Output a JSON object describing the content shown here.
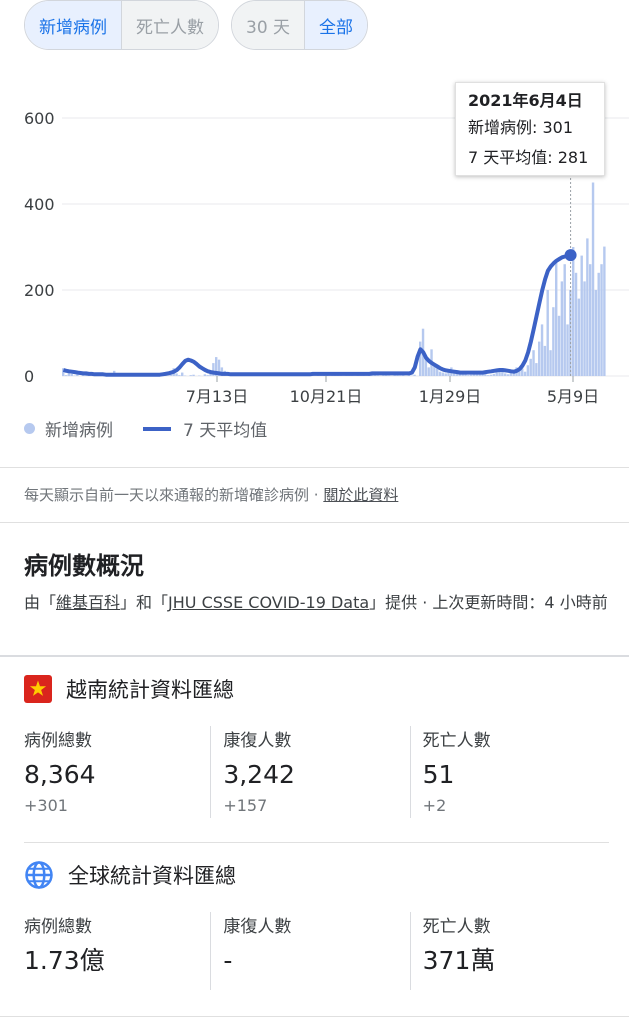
{
  "filters": {
    "metric_tabs": [
      "新增病例",
      "死亡人數"
    ],
    "range_tabs": [
      "30 天",
      "全部"
    ]
  },
  "chart_data": {
    "type": "bar",
    "x_tick_labels": [
      "7月13日",
      "10月21日",
      "1月29日",
      "5月9日"
    ],
    "y_ticks": [
      0,
      200,
      400,
      600
    ],
    "ylim": [
      0,
      600
    ],
    "series": [
      {
        "name": "新增病例",
        "type": "bar",
        "color": "#b6c9ef",
        "values": [
          18,
          2,
          10,
          5,
          1,
          3,
          0,
          8,
          2,
          1,
          0,
          4,
          2,
          0,
          5,
          1,
          0,
          3,
          12,
          1,
          0,
          2,
          6,
          0,
          1,
          3,
          0,
          0,
          4,
          1,
          2,
          0,
          1,
          0,
          2,
          5,
          1,
          0,
          3,
          18,
          6,
          2,
          8,
          1,
          0,
          2,
          3,
          0,
          1,
          0,
          4,
          2,
          8,
          30,
          44,
          38,
          20,
          12,
          8,
          6,
          4,
          3,
          2,
          5,
          1,
          0,
          2,
          3,
          6,
          1,
          0,
          2,
          4,
          0,
          1,
          2,
          0,
          1,
          5,
          2,
          1,
          0,
          3,
          1,
          2,
          0,
          1,
          4,
          2,
          0,
          3,
          1,
          6,
          2,
          0,
          1,
          2,
          5,
          1,
          0,
          2,
          3,
          1,
          0,
          4,
          1,
          2,
          0,
          8,
          2,
          3,
          1,
          0,
          2,
          4,
          1,
          0,
          3,
          2,
          1,
          6,
          0,
          2,
          1,
          3,
          0,
          80,
          110,
          40,
          20,
          62,
          30,
          18,
          10,
          8,
          6,
          12,
          20,
          14,
          8,
          5,
          4,
          6,
          2,
          3,
          8,
          5,
          12,
          6,
          4,
          2,
          3,
          5,
          8,
          10,
          12,
          6,
          4,
          8,
          14,
          20,
          12,
          18,
          10,
          25,
          40,
          60,
          30,
          80,
          120,
          70,
          200,
          60,
          160,
          270,
          140,
          220,
          260,
          120,
          200,
          300,
          240,
          180,
          280,
          220,
          320,
          260,
          450,
          200,
          240,
          260,
          301
        ]
      },
      {
        "name": "7 天平均值",
        "type": "line",
        "color": "#3c62c6",
        "values": [
          14,
          12,
          11,
          10,
          9,
          8,
          7,
          6,
          6,
          5,
          5,
          4,
          4,
          4,
          4,
          3,
          3,
          3,
          3,
          3,
          3,
          3,
          3,
          3,
          3,
          3,
          3,
          3,
          3,
          3,
          3,
          3,
          3,
          3,
          3,
          4,
          5,
          6,
          8,
          10,
          14,
          20,
          28,
          35,
          38,
          36,
          33,
          28,
          22,
          18,
          14,
          11,
          9,
          8,
          7,
          6,
          5,
          5,
          5,
          4,
          4,
          4,
          4,
          4,
          4,
          4,
          4,
          4,
          4,
          4,
          4,
          4,
          4,
          4,
          4,
          4,
          4,
          4,
          4,
          4,
          4,
          4,
          4,
          4,
          4,
          4,
          4,
          4,
          5,
          5,
          5,
          5,
          5,
          5,
          5,
          5,
          5,
          5,
          5,
          5,
          5,
          5,
          5,
          5,
          5,
          5,
          5,
          5,
          5,
          6,
          6,
          6,
          6,
          6,
          6,
          6,
          6,
          6,
          6,
          6,
          6,
          6,
          6,
          8,
          20,
          45,
          62,
          55,
          42,
          35,
          30,
          26,
          22,
          18,
          15,
          13,
          12,
          11,
          10,
          9,
          8,
          8,
          8,
          8,
          8,
          8,
          8,
          8,
          8,
          9,
          10,
          11,
          12,
          13,
          14,
          14,
          13,
          12,
          11,
          10,
          12,
          16,
          24,
          36,
          55,
          80,
          110,
          140,
          170,
          200,
          225,
          245,
          255,
          262,
          268,
          272,
          276,
          278,
          280,
          281
        ]
      }
    ],
    "legend": [
      "新增病例",
      "7 天平均值"
    ],
    "legend_position": "bottom-left",
    "grid": true
  },
  "tooltip": {
    "date": "2021年6月4日",
    "new_cases": "新增病例: 301",
    "avg": "7 天平均值: 281"
  },
  "legend": {
    "bars": "新增病例",
    "line": "7 天平均值"
  },
  "note": {
    "text": "每天顯示自前一天以來通報的新增確診病例 ·",
    "link": "關於此資料"
  },
  "overview": {
    "title": "病例數概況",
    "source_prefix": "由「",
    "source_wiki": "維基百科",
    "source_mid": "」和「",
    "source_jhu": "JHU CSSE COVID-19 Data",
    "source_suffix": "」提供 · 上次更新時間：4 小時前"
  },
  "vietnam": {
    "title": "越南統計資料匯總",
    "stats": [
      {
        "label": "病例總數",
        "value": "8,364",
        "delta": "+301"
      },
      {
        "label": "康復人數",
        "value": "3,242",
        "delta": "+157"
      },
      {
        "label": "死亡人數",
        "value": "51",
        "delta": "+2"
      }
    ]
  },
  "global": {
    "title": "全球統計資料匯總",
    "stats": [
      {
        "label": "病例總數",
        "value": "1.73億"
      },
      {
        "label": "康復人數",
        "value": "-"
      },
      {
        "label": "死亡人數",
        "value": "371萬"
      }
    ]
  },
  "colors": {
    "accent": "#1a73e8",
    "bars": "#b6c9ef",
    "line": "#3c62c6",
    "flag_red": "#da251d",
    "flag_star": "#ffcd00",
    "globe": "#4285f4"
  }
}
